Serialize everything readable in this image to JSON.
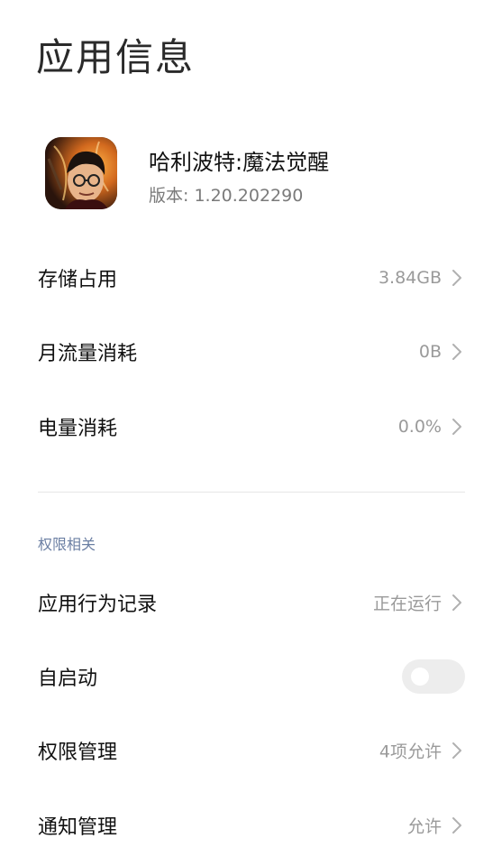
{
  "page": {
    "title": "应用信息"
  },
  "app": {
    "name": "哈利波特:魔法觉醒",
    "version": "版本: 1.20.202290",
    "icon": "harry-potter-app-icon"
  },
  "usage": [
    {
      "label": "存储占用",
      "value": "3.84GB"
    },
    {
      "label": "月流量消耗",
      "value": "0B"
    },
    {
      "label": "电量消耗",
      "value": "0.0%"
    }
  ],
  "permissions": {
    "section_title": "权限相关",
    "behavior_log": {
      "label": "应用行为记录",
      "value": "正在运行"
    },
    "autostart": {
      "label": "自启动",
      "enabled": false
    },
    "permission_manage": {
      "label": "权限管理",
      "value": "4项允许"
    },
    "notification_manage": {
      "label": "通知管理",
      "value": "允许"
    }
  },
  "colors": {
    "section_title": "#6b7fa3",
    "value_text": "#9a9a9a",
    "toggle_off": "#ededed"
  }
}
